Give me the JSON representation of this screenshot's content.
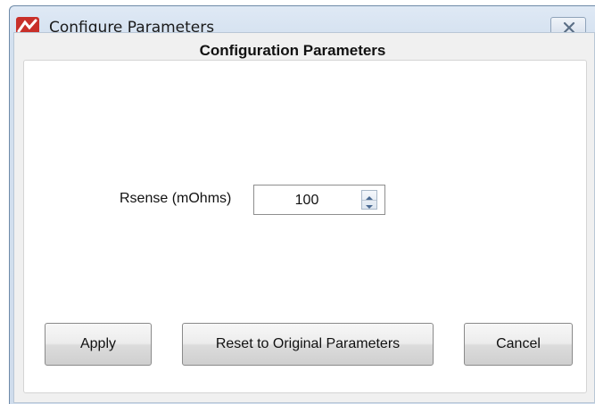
{
  "window": {
    "title": "Configure Parameters",
    "icons": {
      "app": "app-logo-icon",
      "close": "close-icon"
    }
  },
  "panel": {
    "title": "Configuration Parameters"
  },
  "field": {
    "label": "Rsense (mOhms)",
    "value": "100"
  },
  "buttons": {
    "apply": "Apply",
    "reset": "Reset to Original Parameters",
    "cancel": "Cancel"
  },
  "colors": {
    "titlebar": "#d3e0ef",
    "accent_red": "#c8302a"
  }
}
